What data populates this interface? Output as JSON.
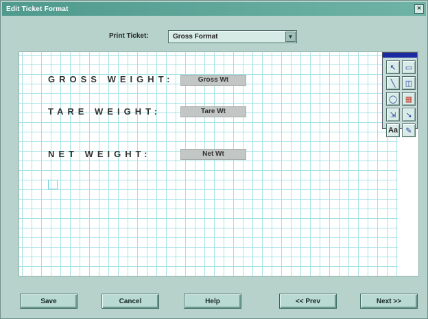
{
  "window": {
    "title": "Edit Ticket Format"
  },
  "ticket": {
    "label": "Print Ticket:",
    "selected": "Gross Format"
  },
  "labels": [
    {
      "text": "GROSS WEIGHT:",
      "field": "Gross Wt"
    },
    {
      "text": "TARE WEIGHT:",
      "field": "Tare Wt"
    },
    {
      "text": "NET WEIGHT:",
      "field": "Net Wt"
    }
  ],
  "palette_tools": [
    "pointer-icon",
    "rectangle-icon",
    "line-icon",
    "shape-icon",
    "ellipse-icon",
    "fill-icon",
    "move-icon",
    "select-icon",
    "text-icon",
    "brush-icon"
  ],
  "buttons": {
    "save": "Save",
    "cancel": "Cancel",
    "help": "Help",
    "prev": "<< Prev",
    "next": "Next >>"
  }
}
